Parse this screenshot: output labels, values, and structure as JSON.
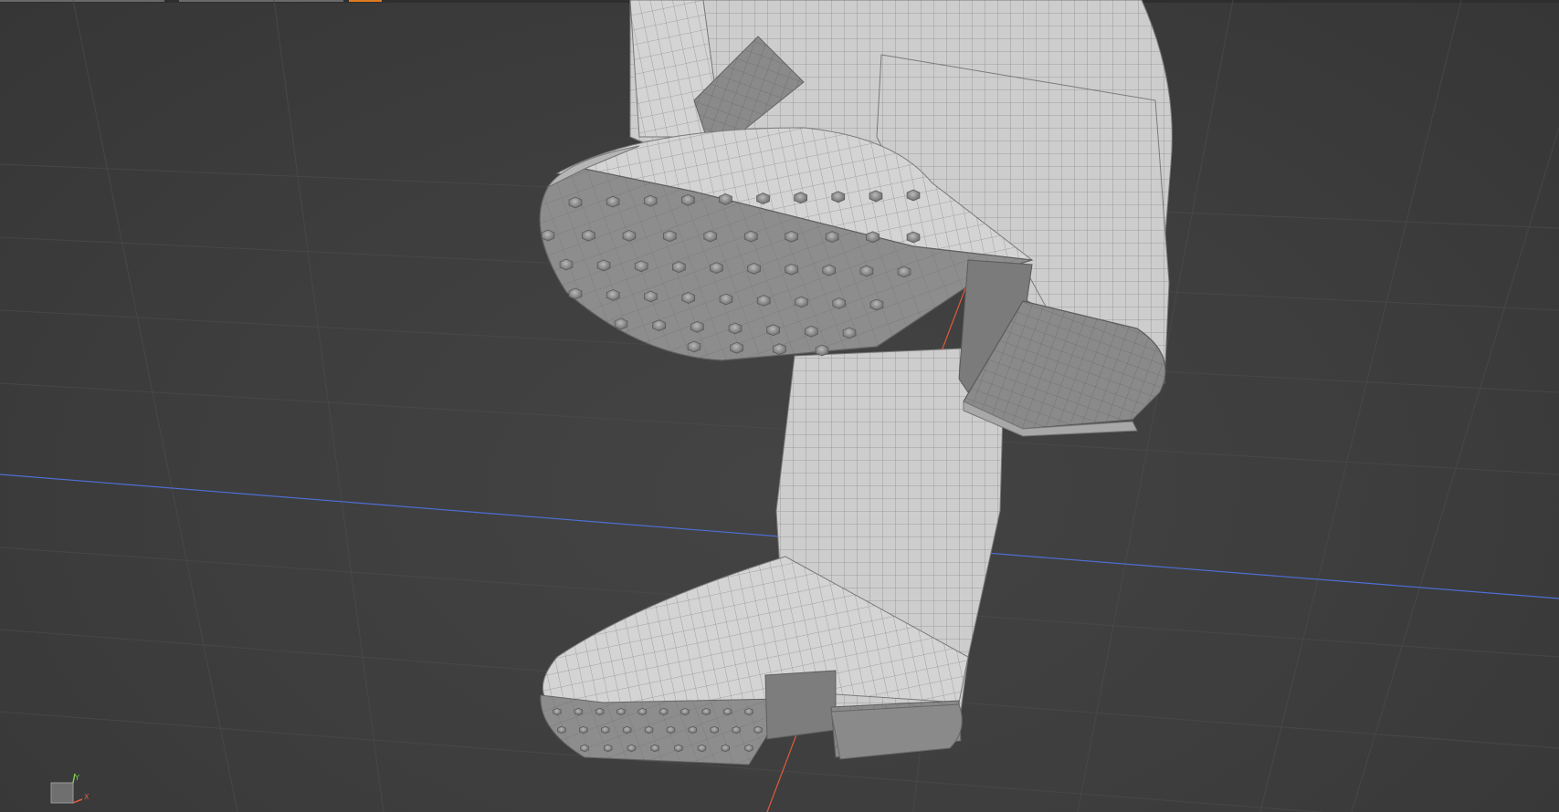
{
  "viewport": {
    "name": "3d-perspective-viewport",
    "background_color": "#3d3d3d",
    "grid_color": "#4a4a4a",
    "model_color": "#cfcfcf",
    "wire_color": "#8c8c8c"
  },
  "axes": {
    "x_color": "#e05a3a",
    "z_color": "#4d6fd6",
    "gizmo": {
      "y_label": "Y",
      "x_label": "X",
      "y_color": "#7ec850",
      "x_color": "#e05a3a"
    }
  },
  "top_toolbar": {
    "accent_color": "#e07a1f"
  }
}
